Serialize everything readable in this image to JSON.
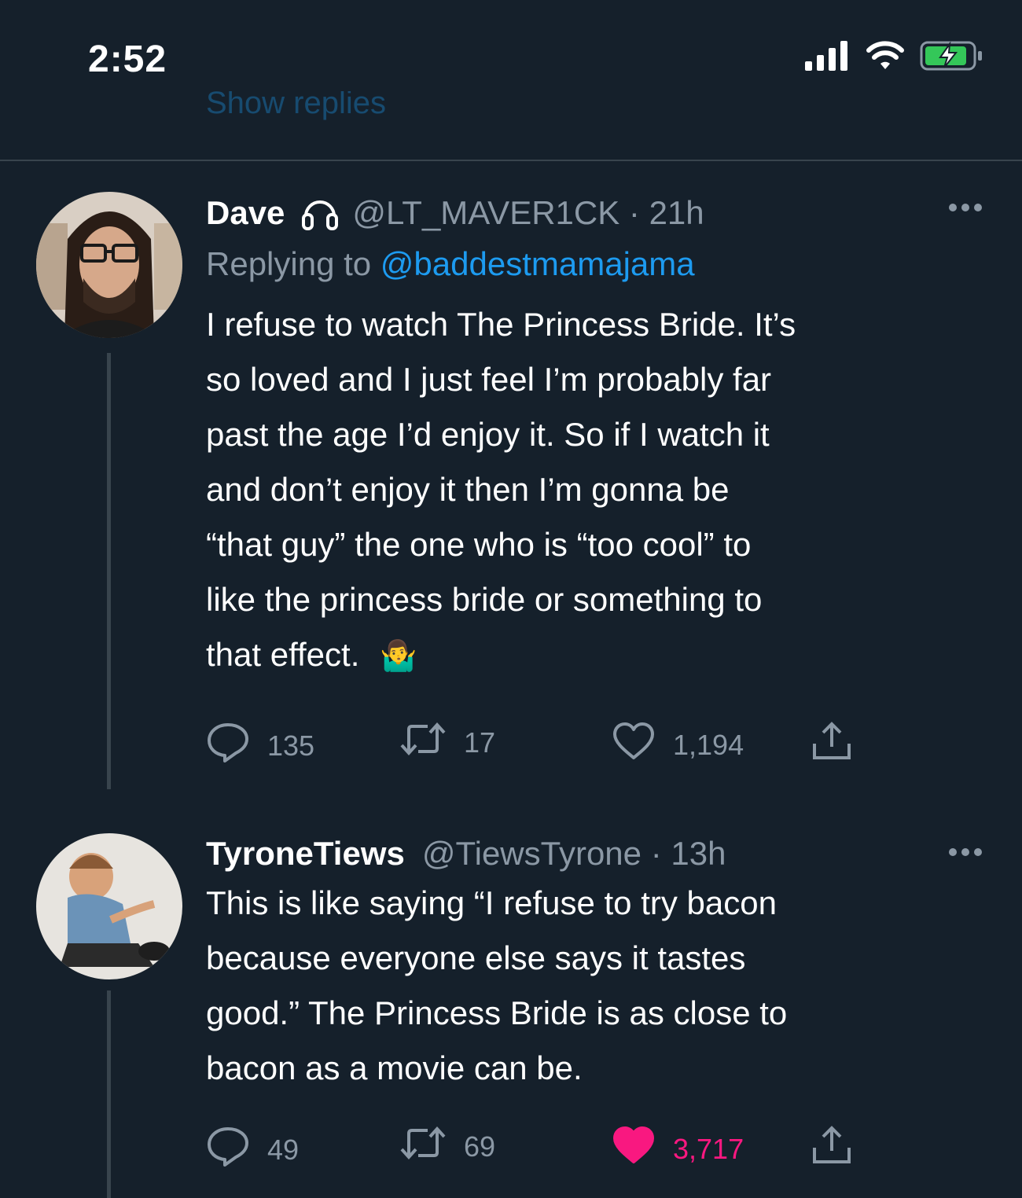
{
  "status_bar": {
    "time": "2:52",
    "icons": [
      "signal-icon",
      "wifi-icon",
      "battery-charging-icon"
    ]
  },
  "faded_link": "Show replies",
  "colors": {
    "background": "#15202b",
    "accent": "#1d9bf0",
    "muted": "#8b98a5",
    "like_active": "#f91880",
    "divider": "#38444d"
  },
  "tweets": [
    {
      "display_name": "Dave",
      "badge_icon": "headphones-icon",
      "handle_meta": "@LT_MAVER1CK · 21h",
      "reply_prefix": "Replying to",
      "reply_mention": "@baddestmamajama",
      "lines": [
        "I refuse to watch The Princess Bride. It’s",
        "so loved and I just feel I’m probably far",
        "past the age I’d enjoy it. So if I watch it",
        "and don’t enjoy it then I’m gonna be",
        "“that guy” the one who is “too cool” to",
        "like the princess bride or something to",
        "that effect."
      ],
      "trailing_emoji": "🤷‍♂️",
      "replies": "135",
      "retweets": "17",
      "likes": "1,194",
      "liked": false
    },
    {
      "display_name": "TyroneTiews",
      "handle_meta": "@TiewsTyrone · 13h",
      "lines": [
        "This is like saying “I refuse to try bacon",
        "because everyone else says it tastes",
        "good.” The Princess Bride is as close to",
        "bacon as a movie can be."
      ],
      "replies": "49",
      "retweets": "69",
      "likes": "3,717",
      "liked": true
    }
  ]
}
